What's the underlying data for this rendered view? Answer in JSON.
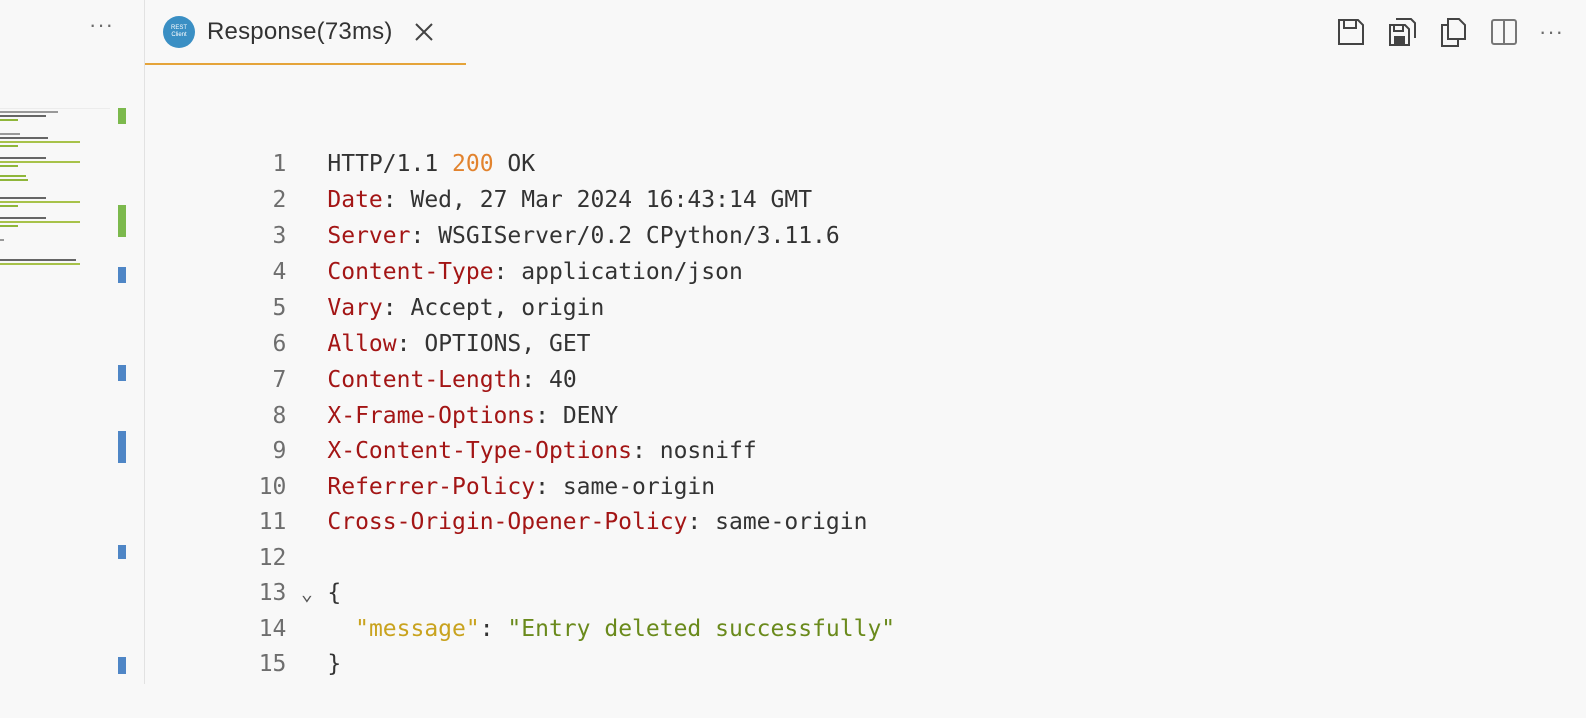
{
  "left_pane": {
    "more_label": "···"
  },
  "tab": {
    "icon_text_top": "REST",
    "icon_text_bottom": "Client",
    "title": "Response(73ms)",
    "close_label": "×"
  },
  "toolbar": {
    "more_label": "···"
  },
  "colors": {
    "accent": "#e5a43a",
    "header_name": "#a31515",
    "status_code": "#e2832e",
    "json_key": "#c9a31f",
    "json_string": "#6a8a1c",
    "gutter_added": "#7cb94d",
    "gutter_modified": "#4f86c6"
  },
  "response": {
    "status_line": {
      "num": "1",
      "protocol": "HTTP/1.1 ",
      "code": "200",
      "text": " OK"
    },
    "headers": [
      {
        "num": "2",
        "name": "Date",
        "value": "Wed, 27 Mar 2024 16:43:14 GMT"
      },
      {
        "num": "3",
        "name": "Server",
        "value": "WSGIServer/0.2 CPython/3.11.6"
      },
      {
        "num": "4",
        "name": "Content-Type",
        "value": "application/json"
      },
      {
        "num": "5",
        "name": "Vary",
        "value": "Accept, origin"
      },
      {
        "num": "6",
        "name": "Allow",
        "value": "OPTIONS, GET"
      },
      {
        "num": "7",
        "name": "Content-Length",
        "value": "40"
      },
      {
        "num": "8",
        "name": "X-Frame-Options",
        "value": "DENY"
      },
      {
        "num": "9",
        "name": "X-Content-Type-Options",
        "value": "nosniff"
      },
      {
        "num": "10",
        "name": "Referrer-Policy",
        "value": "same-origin"
      },
      {
        "num": "11",
        "name": "Cross-Origin-Opener-Policy",
        "value": "same-origin"
      }
    ],
    "sep": ": ",
    "blank_line": {
      "num": "12"
    },
    "body_open": {
      "num": "13",
      "text": "{"
    },
    "body_entry": {
      "num": "14",
      "key": "\"message\"",
      "colon": ": ",
      "value": "\"Entry deleted successfully\""
    },
    "body_close": {
      "num": "15",
      "text": "}"
    }
  }
}
